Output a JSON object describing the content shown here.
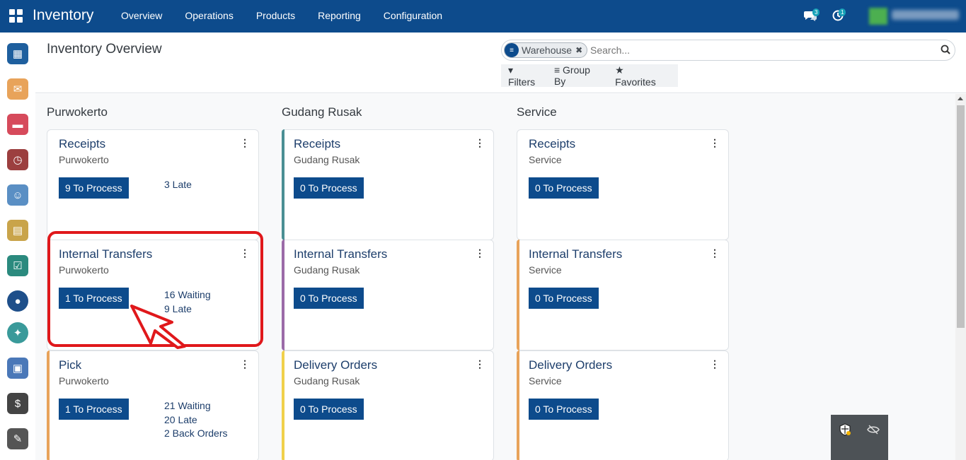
{
  "app": {
    "name": "Inventory"
  },
  "menu": [
    "Overview",
    "Operations",
    "Products",
    "Reporting",
    "Configuration"
  ],
  "systray": {
    "messages_count": "3",
    "activities_count": "1"
  },
  "page_title": "Inventory Overview",
  "search": {
    "facet": "Warehouse",
    "placeholder": "Search..."
  },
  "filters": {
    "filters": "Filters",
    "group_by": "Group By",
    "favorites": "Favorites"
  },
  "columns": [
    {
      "title": "Purwokerto"
    },
    {
      "title": "Gudang Rusak"
    },
    {
      "title": "Service"
    }
  ],
  "cards": {
    "c0r0": {
      "title": "Receipts",
      "warehouse": "Purwokerto",
      "button": "9 To Process",
      "stats": [
        "3 Late"
      ]
    },
    "c0r1": {
      "title": "Internal Transfers",
      "warehouse": "Purwokerto",
      "button": "1 To Process",
      "stats": [
        "16 Waiting",
        "9 Late"
      ]
    },
    "c0r2": {
      "title": "Pick",
      "warehouse": "Purwokerto",
      "button": "1 To Process",
      "stats": [
        "21 Waiting",
        "20 Late",
        "2 Back Orders"
      ]
    },
    "c1r0": {
      "title": "Receipts",
      "warehouse": "Gudang Rusak",
      "button": "0 To Process",
      "stats": []
    },
    "c1r1": {
      "title": "Internal Transfers",
      "warehouse": "Gudang Rusak",
      "button": "0 To Process",
      "stats": []
    },
    "c1r2": {
      "title": "Delivery Orders",
      "warehouse": "Gudang Rusak",
      "button": "0 To Process",
      "stats": []
    },
    "c2r0": {
      "title": "Receipts",
      "warehouse": "Service",
      "button": "0 To Process",
      "stats": []
    },
    "c2r1": {
      "title": "Internal Transfers",
      "warehouse": "Service",
      "button": "0 To Process",
      "stats": []
    },
    "c2r2": {
      "title": "Delivery Orders",
      "warehouse": "Service",
      "button": "0 To Process",
      "stats": []
    }
  },
  "colors": {
    "navbar": "#0d4b8c",
    "button": "#0d4b8c",
    "highlight": "#e0181b"
  }
}
